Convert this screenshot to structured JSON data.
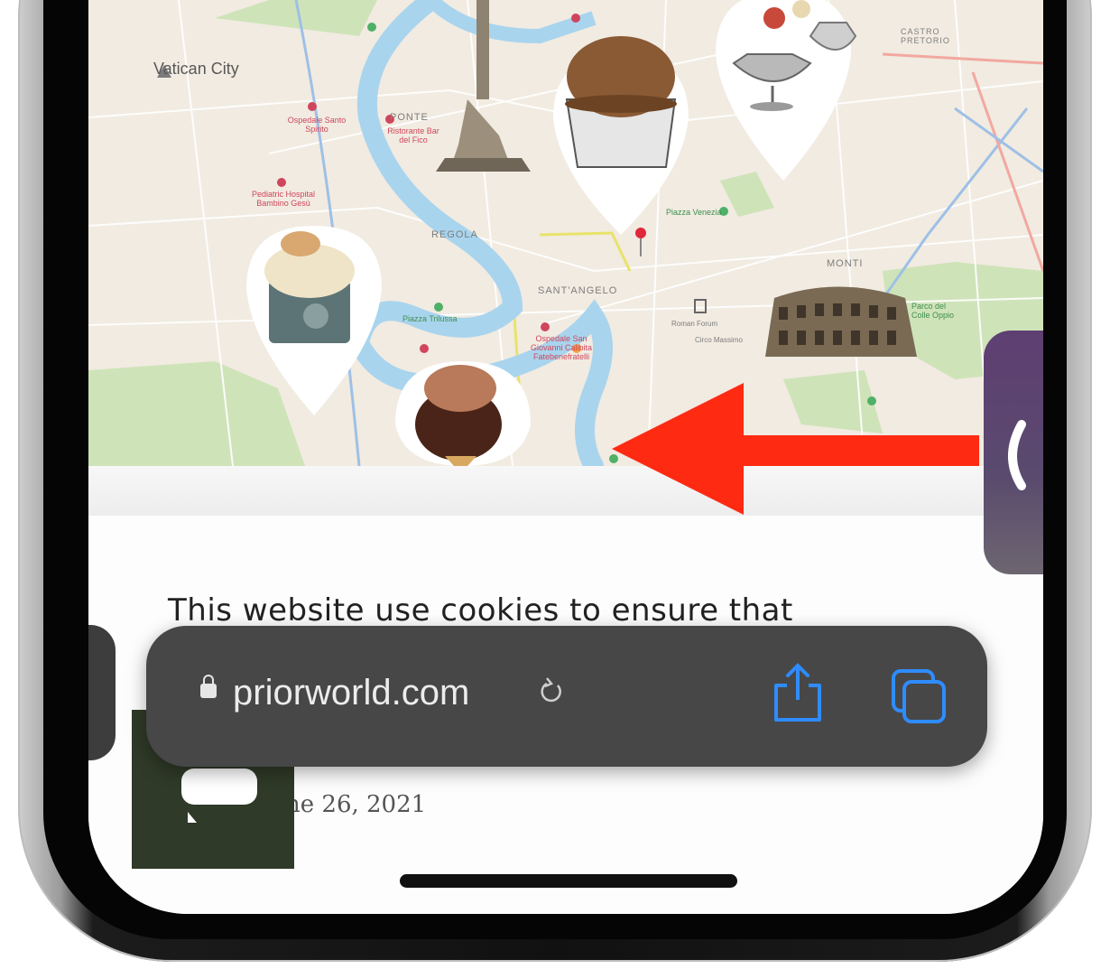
{
  "map": {
    "city_label": "Vatican City",
    "district_labels": [
      "PONTE",
      "REGOLA",
      "SANT'ANGELO",
      "MONTI",
      "CASTRO PRETORIO"
    ],
    "poi_labels": [
      "Ospedale Santo Spirito",
      "Pediatric Hospital Bambino Gesù",
      "Ristorante Bar del Fico",
      "Piazza Venezia",
      "Piazza Trilussa",
      "Ospedale San Giovanni Calibita Fatebenefratelli",
      "Parco del Colle Oppio",
      "Roman Forum",
      "Circo Massimo"
    ],
    "park_labels": [
      "Piazza Venezia",
      "Piazza Trilussa",
      "Parco del Colle Oppio"
    ],
    "colors": {
      "river": "#a9d4ee",
      "park": "#cfe3b9",
      "land": "#f1ebe1",
      "road_minor": "#ffffff"
    }
  },
  "page": {
    "cookie_text": "This website use cookies to ensure that",
    "post_date": "ne 26, 2021"
  },
  "browser": {
    "url": "priorworld.com",
    "icons": {
      "lock": "lock-icon",
      "reload": "reload-icon",
      "share": "share-icon",
      "tabs": "tabs-icon"
    },
    "accent": "#2f8cff"
  },
  "side_tab": {
    "glyph": "〈"
  },
  "annotation": {
    "arrow_color": "#ff2a12"
  }
}
